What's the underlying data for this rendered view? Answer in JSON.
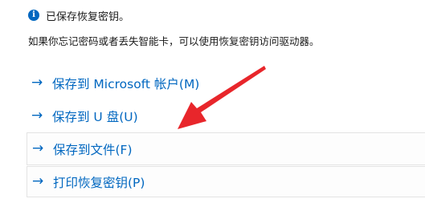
{
  "info": {
    "icon": "info-icon",
    "icon_glyph": "i",
    "message": "已保存恢复密钥。"
  },
  "description": "如果你忘记密码或者丢失智能卡，可以使用恢复密钥访问驱动器。",
  "options": [
    {
      "arrow": "→",
      "label": "保存到 Microsoft 帐户(M)"
    },
    {
      "arrow": "→",
      "label": "保存到 U 盘(U)"
    },
    {
      "arrow": "→",
      "label": "保存到文件(F)"
    },
    {
      "arrow": "→",
      "label": "打印恢复密钥(P)"
    }
  ],
  "colors": {
    "accent": "#0067c0",
    "annotation_arrow": "#e8262b"
  }
}
